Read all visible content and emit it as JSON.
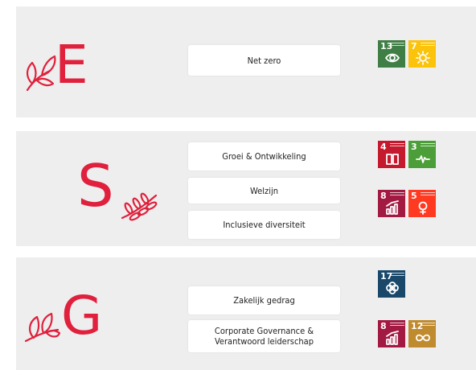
{
  "environmental": {
    "letter": "E",
    "items": [
      "Net zero"
    ],
    "sdgs": [
      {
        "number": "13",
        "icon": "eye-earth-icon",
        "color": "#3f7e44"
      },
      {
        "number": "7",
        "icon": "sun-icon",
        "color": "#fcc30b"
      }
    ]
  },
  "social": {
    "letter": "S",
    "items": [
      "Groei & Ontwikkeling",
      "Welzijn",
      "Inclusieve diversiteit"
    ],
    "sdgs": [
      {
        "number": "4",
        "icon": "book-icon",
        "color": "#c5192d"
      },
      {
        "number": "3",
        "icon": "heartbeat-icon",
        "color": "#4c9f38"
      },
      {
        "number": "8",
        "icon": "growth-chart-icon",
        "color": "#a21942"
      },
      {
        "number": "5",
        "icon": "gender-equality-icon",
        "color": "#ff3a21"
      }
    ]
  },
  "governance": {
    "letter": "G",
    "items": [
      "Zakelijk gedrag",
      "Corporate Governance &",
      "Verantwoord leiderschap"
    ],
    "sdgs": [
      {
        "number": "17",
        "icon": "partnership-rings-icon",
        "color": "#19486a"
      },
      {
        "number": "8",
        "icon": "growth-chart-icon",
        "color": "#a21942"
      },
      {
        "number": "12",
        "icon": "infinity-icon",
        "color": "#bf8b2e"
      }
    ]
  }
}
